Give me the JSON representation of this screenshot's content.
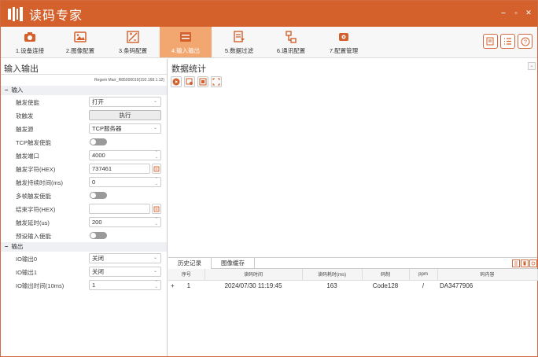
{
  "app": {
    "title": "读码专家",
    "brand_color": "#d4602c"
  },
  "window_controls": [
    "‒",
    "▫",
    "✕"
  ],
  "toolbar": {
    "items": [
      {
        "label": "1.设备连接",
        "icon": "camera-icon"
      },
      {
        "label": "2.图像配置",
        "icon": "image-icon"
      },
      {
        "label": "3.条码配置",
        "icon": "barcode-config-icon"
      },
      {
        "label": "4.输入输出",
        "icon": "io-icon",
        "active": true
      },
      {
        "label": "5.数据过滤",
        "icon": "filter-icon"
      },
      {
        "label": "6.通讯配置",
        "icon": "network-icon"
      },
      {
        "label": "7.配置管理",
        "icon": "settings-box-icon"
      }
    ],
    "right_buttons": [
      "notes-icon",
      "list-icon",
      "help-icon"
    ]
  },
  "left": {
    "title": "输入输出",
    "device": "Regem Marr_R85000019(192.168.1.12)",
    "input_section": "输入",
    "output_section": "输出",
    "minus": "−",
    "rows": {
      "trigger_enable": {
        "label": "触发使能",
        "value": "打开"
      },
      "soft_trigger": {
        "label": "软触发",
        "button": "执行"
      },
      "trigger_source": {
        "label": "触发源",
        "value": "TCP服务器"
      },
      "tcp_trigger_enable": {
        "label": "TCP触发使能"
      },
      "trigger_port": {
        "label": "触发端口",
        "value": "4000"
      },
      "trigger_string": {
        "label": "触发字符(HEX)",
        "value": "737461"
      },
      "trigger_hold": {
        "label": "触发持续时间(ms)",
        "value": "0"
      },
      "multi_trigger": {
        "label": "多帧触发使能"
      },
      "end_string": {
        "label": "结束字符(HEX)",
        "value": ""
      },
      "trigger_delay": {
        "label": "触发延时(us)",
        "value": "200"
      },
      "preset_input": {
        "label": "预设输入使能"
      },
      "io_out0": {
        "label": "IO输出0",
        "value": "关闭"
      },
      "io_out1": {
        "label": "IO输出1",
        "value": "关闭"
      },
      "io_out_time": {
        "label": "IO输出时间(10ms)",
        "value": "1"
      }
    }
  },
  "right": {
    "title": "数据统计",
    "collapse": "⌄",
    "tabs": [
      "历史记录",
      "图像缓存"
    ],
    "columns": [
      "序号",
      "读码时间",
      "读码耗时(ms)",
      "码制",
      "ppm",
      "码内容"
    ],
    "rows": [
      {
        "expand": "+",
        "index": "1",
        "time": "2024/07/30 11:19:45",
        "cost": "163",
        "symbology": "Code128",
        "ppm": "/",
        "content": "DA3477906"
      }
    ]
  }
}
